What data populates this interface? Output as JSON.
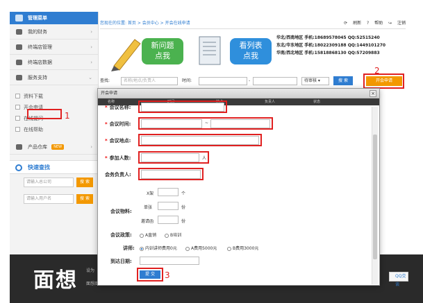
{
  "sidebar": {
    "title": "管理菜单",
    "items": [
      {
        "label": "我的财务",
        "arrow": "›"
      },
      {
        "label": "终端店管理",
        "arrow": "›"
      },
      {
        "label": "终端店数据",
        "arrow": "›"
      },
      {
        "label": "服务支持",
        "arrow": "⌄"
      }
    ],
    "sub_items": [
      "资料下载",
      "开会申请",
      "在线提问",
      "在线帮助"
    ],
    "product": {
      "label": "产品仓库",
      "badge": "NEW",
      "arrow": "›"
    },
    "quick_search": {
      "title": "快速查找",
      "fields": [
        {
          "placeholder": "请输入总公司",
          "button": "搜 索"
        },
        {
          "placeholder": "请输入用户名",
          "button": "搜 索"
        }
      ]
    }
  },
  "topbar": {
    "breadcrumb": "您现在的位置: 首页 > 会员中心 > 开会在线申请",
    "refresh": "刷新",
    "help": "帮助",
    "logout": "注销"
  },
  "banners": [
    {
      "text1": "新问题",
      "text2": "点我"
    },
    {
      "text1": "看列表",
      "text2": "点我"
    }
  ],
  "contacts": [
    "华北/西南地区  手机:18689578045  QQ:52515240",
    "东北/华东地区  手机:18022309188  QQ:1449101270",
    "华南/西北地区  手机:15818868130  QQ:57209883"
  ],
  "search": {
    "label_find": "查找:",
    "find_placeholder": "名称/地点/负责人",
    "label_time": "时间:",
    "dash": "-",
    "status": "待审核",
    "button": "搜 索"
  },
  "open_button": "开会申请",
  "dialog": {
    "title": "开会申请",
    "close": "×",
    "header_cols": [
      "名称",
      "时间",
      "地点",
      "负责人",
      "状态"
    ],
    "fields": {
      "name": "会议名称:",
      "time": "会议时间:",
      "time_sep": "~",
      "place": "会议地点:",
      "people": "参加人数:",
      "people_unit": "人",
      "owner": "会务负责人:",
      "materials": "会议物料:",
      "x_rack": "X架",
      "x_unit": "个",
      "flyer": "单张",
      "flyer_unit": "份",
      "invite": "邀请函",
      "invite_unit": "份",
      "policy": "会议政策:",
      "policy_a": "A直销",
      "policy_b": "B培训",
      "lecturer": "讲师:",
      "lec_1": "内训讲师费用0元",
      "lec_2": "A费用5000元",
      "lec_3": "B费用3000元",
      "arrival": "到达日期:"
    },
    "submit": "提 交"
  },
  "annotations": {
    "n1": "1",
    "n2": "2",
    "n3": "3"
  },
  "footer": {
    "logo": "面想",
    "text1": "设为",
    "text2": "面想商城©版权所有"
  },
  "qq_chat": "QQ交谈",
  "colors": {
    "accent": "#2f7dd1",
    "orange": "#f39800",
    "annot": "#e02020"
  }
}
